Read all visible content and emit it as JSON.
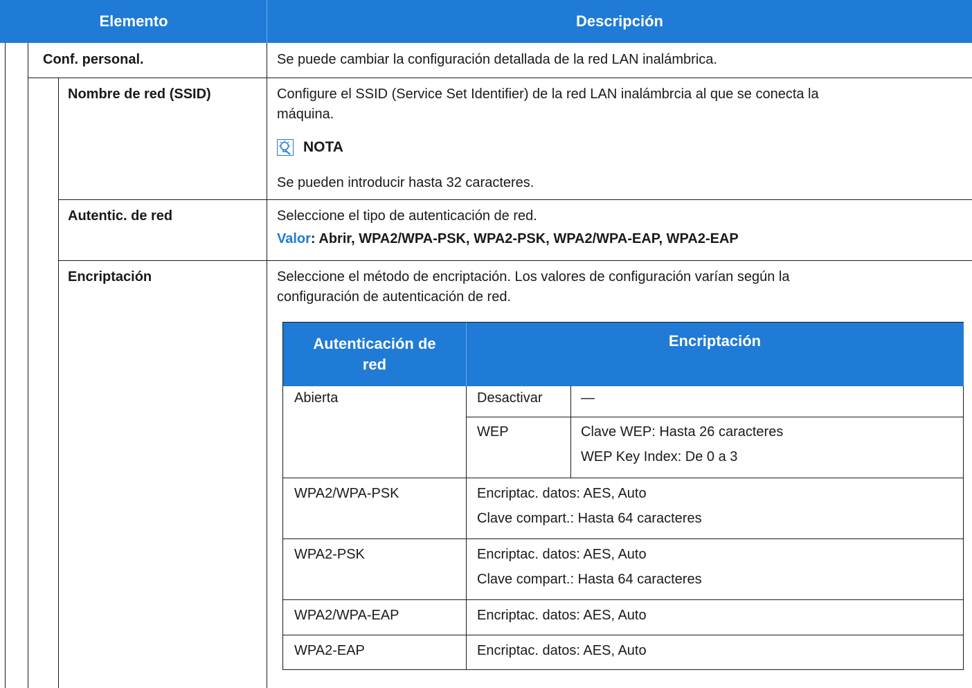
{
  "header": {
    "col_element": "Elemento",
    "col_description": "Descripción"
  },
  "rows": {
    "conf_personal": {
      "label": "Conf. personal.",
      "desc": "Se puede cambiar la configuración detallada de la red LAN inalámbrica."
    },
    "ssid": {
      "label": "Nombre de red (SSID)",
      "desc_line1": "Configure el SSID (Service Set Identifier) de la red LAN inalámbrcia al que se conecta la",
      "desc_line2": "máquina.",
      "note_label": "NOTA",
      "note_text": "Se pueden introducir hasta 32 caracteres."
    },
    "auth": {
      "label": "Autentic. de red",
      "desc": "Seleccione el tipo de autenticación de red.",
      "valor_key": "Valor",
      "valor_values": ": Abrir, WPA2/WPA-PSK, WPA2-PSK, WPA2/WPA-EAP, WPA2-EAP"
    },
    "encryption": {
      "label": "Encriptación",
      "desc_line1": "Seleccione el método de encriptación. Los valores de configuración varían según la",
      "desc_line2": "configuración de autenticación de red."
    }
  },
  "inner_table": {
    "header_auth_line1": "Autenticación de",
    "header_auth_line2": "red",
    "header_enc": "Encriptación",
    "abierta": {
      "auth": "Abierta",
      "desactivar": "Desactivar",
      "desactivar_val": "—",
      "wep": "WEP",
      "wep_val1": "Clave WEP: Hasta 26 caracteres",
      "wep_val2": "WEP Key Index: De 0 a 3"
    },
    "wpa2_wpa_psk": {
      "auth": "WPA2/WPA-PSK",
      "line1": "Encriptac. datos: AES, Auto",
      "line2": "Clave compart.: Hasta 64 caracteres"
    },
    "wpa2_psk": {
      "auth": "WPA2-PSK",
      "line1": "Encriptac. datos: AES, Auto",
      "line2": "Clave compart.: Hasta 64 caracteres"
    },
    "wpa2_wpa_eap": {
      "auth": "WPA2/WPA-EAP",
      "line1": "Encriptac. datos: AES, Auto"
    },
    "wpa2_eap": {
      "auth": "WPA2-EAP",
      "line1": "Encriptac. datos: AES, Auto"
    }
  },
  "colors": {
    "header_bg": "#1f7bd6",
    "accent": "#1f7bd6"
  }
}
